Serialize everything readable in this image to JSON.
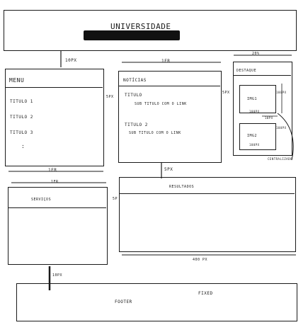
{
  "header": {
    "title": "UNIVERSIDADE"
  },
  "gaps": {
    "header_gap": "10PX",
    "menu_news_gap": "5PX",
    "news_dest_gap": "5PX",
    "row_gap": "5PX",
    "services_results_gap": "5P",
    "footer_gap": "10PX"
  },
  "menu": {
    "title": "MENU",
    "items": [
      "TITULO 1",
      "TITULO 2",
      "TITULO 3"
    ],
    "more": ":",
    "width": "1FR"
  },
  "news": {
    "title": "NOTÍCIAS",
    "width": "1FR",
    "items": [
      {
        "title": "TITULO",
        "sub": "SUB TITULO COM O LINK"
      },
      {
        "title": "TITULO 2",
        "sub": "SUB TITULO COM O LINK"
      }
    ]
  },
  "destaque": {
    "title": "DESTAQUE",
    "width": "20%",
    "images": [
      {
        "label": "IMG1",
        "w": "100PX",
        "h": "100PX"
      },
      {
        "label": "IMG2",
        "w": "100PX",
        "h": "100PX"
      }
    ],
    "gap": "10PX",
    "note": "CENTRALIZADO"
  },
  "services": {
    "title": "SERVIÇOS",
    "width": "1FR"
  },
  "results": {
    "title": "RESULTADOS",
    "width": "400 PX"
  },
  "footer": {
    "title": "FOOTER",
    "note": "FIXED"
  }
}
